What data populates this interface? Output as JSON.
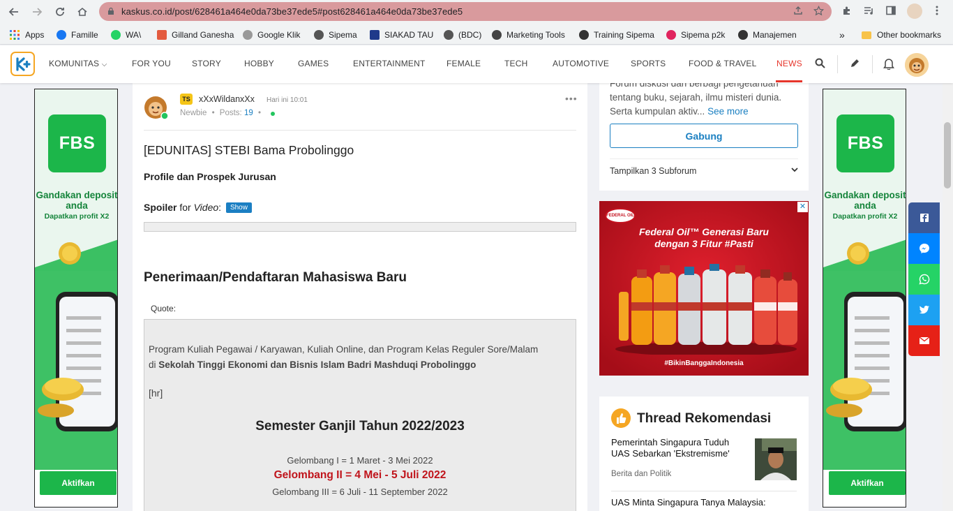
{
  "browser": {
    "url": "kaskus.co.id/post/628461a464e0da73be37ede5#post628461a464e0da73be37ede5",
    "bookmarks": [
      {
        "label": "Apps",
        "color": "#4285f4"
      },
      {
        "label": "Famille",
        "color": "#1877f2"
      },
      {
        "label": "WA\\",
        "color": "#25d366"
      },
      {
        "label": "Gilland Ganesha",
        "color": "#e35b3f"
      },
      {
        "label": "Google Klik",
        "color": "#777777"
      },
      {
        "label": "Sipema",
        "color": "#555555"
      },
      {
        "label": "SIAKAD TAU",
        "color": "#1f3a8a"
      },
      {
        "label": "(BDC)",
        "color": "#555555"
      },
      {
        "label": "Marketing Tools",
        "color": "#444444"
      },
      {
        "label": "Training Sipema",
        "color": "#333333"
      },
      {
        "label": "Sipema p2k",
        "color": "#e0245e"
      },
      {
        "label": "Manajemen",
        "color": "#333333"
      }
    ],
    "other_bookmarks": "Other bookmarks",
    "more_bookmarks": "»"
  },
  "header": {
    "nav": [
      {
        "label": "KOMUNITAS"
      },
      {
        "label": "FOR YOU"
      },
      {
        "label": "STORY"
      },
      {
        "label": "HOBBY"
      },
      {
        "label": "GAMES"
      },
      {
        "label": "ENTERTAINMENT"
      },
      {
        "label": "FEMALE"
      },
      {
        "label": "TECH"
      },
      {
        "label": "AUTOMOTIVE"
      },
      {
        "label": "SPORTS"
      },
      {
        "label": "FOOD & TRAVEL"
      },
      {
        "label": "NEWS"
      }
    ],
    "brand_color": "#1a7fc1",
    "active_color": "#e6352b"
  },
  "side_ad": {
    "logo": "FBS",
    "headline": "Gandakan deposit anda",
    "sub": "Dapatkan profit X2",
    "button": "Aktifkan",
    "color": "#1cb64a"
  },
  "post": {
    "badge": "TS",
    "username": "xXxWildanxXx",
    "time": "Hari ini 10:01",
    "rank": "Newbie",
    "posts_label": "Posts:",
    "posts_count": "19",
    "title": "[EDUNITAS] STEBI Bama Probolinggo",
    "subtitle": "Profile dan Prospek Jurusan",
    "spoiler_bold": "Spoiler",
    "spoiler_for": "for",
    "spoiler_topic": "Video",
    "spoiler_colon": ":",
    "show_btn": "Show",
    "section_heading": "Penerimaan/Pendaftaran Mahasiswa Baru",
    "quote_label": "Quote:",
    "quote": {
      "p1": "Program Kuliah Pegawai / Karyawan, Kuliah Online, dan Program Kelas Reguler Sore/Malam",
      "p1_prefix": "di",
      "p1_bold": "Sekolah Tinggi Ekonomi dan Bisnis Islam Badri Mashduqi Probolinggo",
      "hr": "[hr]",
      "semester": "Semester Ganjil Tahun 2022/2023",
      "gel1": "Gelombang I = 1 Maret - 3 Mei 2022",
      "gel2": "Gelombang II = 4 Mei - 5 Juli 2022",
      "gel3": "Gelombang III = 6 Juli - 11 September 2022"
    }
  },
  "community_card": {
    "desc_prefix": "Forum diskusi dan berbagi pengetahuan tentang buku, sejarah, ilmu misteri dunia. Serta kumpulan aktiv...",
    "see_more": "See more",
    "join": "Gabung",
    "subforum": "Tampilkan 3 Subforum"
  },
  "oil_ad": {
    "logo": "FEDERAL OIL",
    "headline1": "Federal Oil™ Generasi Baru",
    "headline2": "dengan 3 Fitur #Pasti",
    "tag": "#BikinBanggaIndonesia",
    "close": "✕"
  },
  "thread_rec": {
    "heading": "Thread Rekomendasi",
    "items": [
      {
        "title": "Pemerintah Singapura Tuduh UAS Sebarkan 'Ekstremisme'",
        "category": "Berita dan Politik"
      },
      {
        "title": "UAS Minta Singapura Tanya Malaysia:",
        "category": ""
      }
    ]
  },
  "share": {
    "colors": [
      "#3b5998",
      "#0084ff",
      "#25d366",
      "#1da1f2",
      "#e62117"
    ]
  }
}
